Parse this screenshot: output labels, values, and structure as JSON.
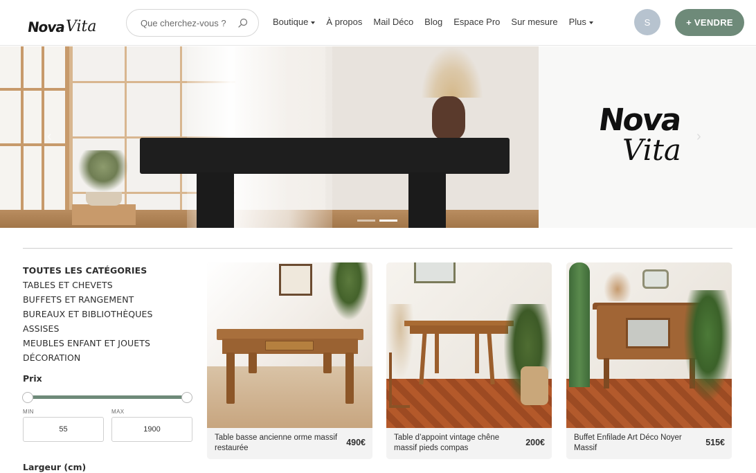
{
  "brand": {
    "logo_part1": "Nova",
    "logo_part2": "Vita"
  },
  "search": {
    "placeholder": "Que cherchez-vous ?",
    "icon": "search-icon"
  },
  "nav": {
    "items": [
      {
        "label": "Boutique",
        "has_dropdown": true
      },
      {
        "label": "À propos",
        "has_dropdown": false
      },
      {
        "label": "Mail Déco",
        "has_dropdown": false
      },
      {
        "label": "Blog",
        "has_dropdown": false
      },
      {
        "label": "Espace Pro",
        "has_dropdown": false
      },
      {
        "label": "Sur mesure",
        "has_dropdown": false
      },
      {
        "label": "Plus",
        "has_dropdown": true
      }
    ]
  },
  "user": {
    "avatar_initial": "S",
    "avatar_color": "#b7c3cf"
  },
  "sell_button": {
    "label": "+ VENDRE",
    "color": "#6e8a79"
  },
  "hero": {
    "logo_part1": "Nova",
    "logo_part2": "Vita",
    "slides_count": 2,
    "active_slide": 2,
    "prev_icon": "chevron-left-icon",
    "next_icon": "chevron-right-icon"
  },
  "categories": {
    "items": [
      {
        "label": "TOUTES LES CATÉGORIES",
        "active": true
      },
      {
        "label": "TABLES ET CHEVETS",
        "active": false
      },
      {
        "label": "BUFFETS ET RANGEMENT",
        "active": false
      },
      {
        "label": "BUREAUX ET BIBLIOTHÈQUES",
        "active": false
      },
      {
        "label": "ASSISES",
        "active": false
      },
      {
        "label": "MEUBLES ENFANT ET JOUETS",
        "active": false
      },
      {
        "label": "DÉCORATION",
        "active": false
      }
    ]
  },
  "filters": {
    "price": {
      "title": "Prix",
      "min_label": "MIN",
      "max_label": "MAX",
      "min_value": "55",
      "max_value": "1900",
      "accent": "#6e8a79"
    },
    "width": {
      "title": "Largeur (cm)"
    }
  },
  "products": [
    {
      "title": "Table basse ancienne orme massif restaurée",
      "price": "490€"
    },
    {
      "title": "Table d’appoint vintage chêne massif pieds compas",
      "price": "200€"
    },
    {
      "title": "Buffet Enfilade Art Déco Noyer Massif",
      "price": "515€"
    }
  ]
}
